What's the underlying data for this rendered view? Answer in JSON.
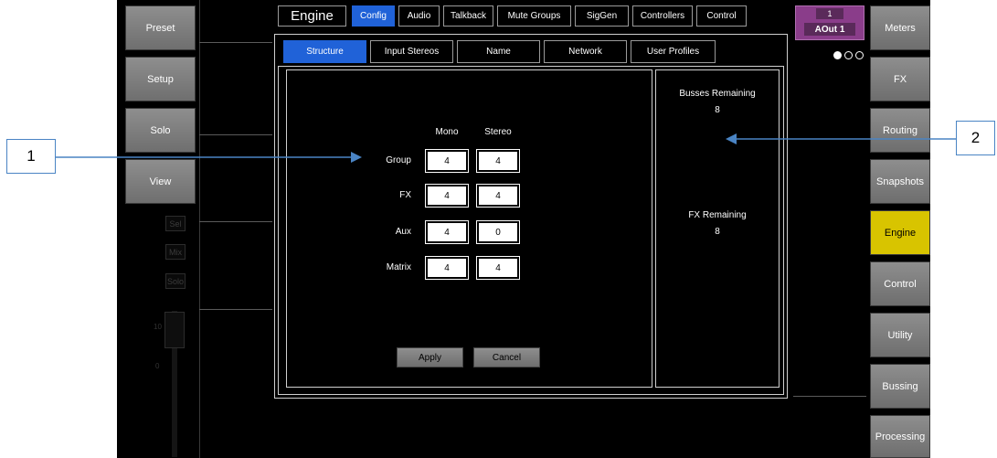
{
  "left_buttons": [
    "Preset",
    "Setup",
    "Solo",
    "View"
  ],
  "strip": {
    "sel": "Sel",
    "mix": "Mix",
    "solo": "Solo",
    "scale_10": "10",
    "scale_0": "0"
  },
  "header": {
    "title": "Engine",
    "channel_number": "1",
    "channel_name": "AOut 1"
  },
  "tabs": [
    "Config",
    "Audio",
    "Talkback",
    "Mute Groups",
    "SigGen",
    "Controllers",
    "Control"
  ],
  "active_tab": "Config",
  "subtabs": [
    "Structure",
    "Input Stereos",
    "Name",
    "Network",
    "User Profiles"
  ],
  "active_subtab": "Structure",
  "structure": {
    "col_mono": "Mono",
    "col_stereo": "Stereo",
    "rows": [
      {
        "label": "Group",
        "mono": "4",
        "stereo": "4"
      },
      {
        "label": "FX",
        "mono": "4",
        "stereo": "4"
      },
      {
        "label": "Aux",
        "mono": "4",
        "stereo": "0"
      },
      {
        "label": "Matrix",
        "mono": "4",
        "stereo": "4"
      }
    ],
    "apply": "Apply",
    "cancel": "Cancel"
  },
  "remaining": {
    "busses_label": "Busses Remaining",
    "busses_value": "8",
    "fx_label": "FX Remaining",
    "fx_value": "8"
  },
  "right_buttons": [
    "Meters",
    "FX",
    "Routing",
    "Snapshots",
    "Engine",
    "Control",
    "Utility",
    "Bussing",
    "Processing"
  ],
  "active_right": "Engine",
  "callouts": {
    "one": "1",
    "two": "2"
  },
  "colors": {
    "active_tab": "#2062d8",
    "active_menu": "#d8c400",
    "channel_badge": "#8a3d8a",
    "arrow": "#4a84c4"
  }
}
